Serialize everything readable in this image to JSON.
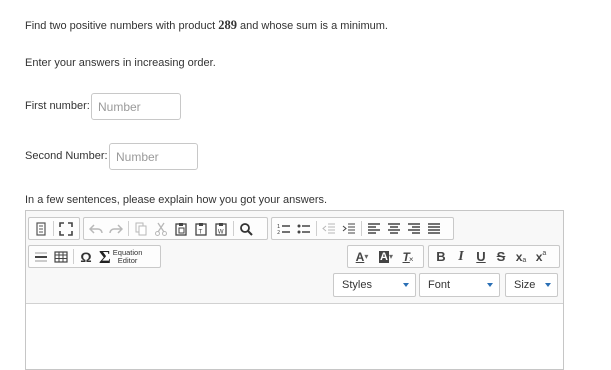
{
  "question": {
    "prefix": "Find two positive numbers with product ",
    "product": "289",
    "suffix": " and whose sum is a minimum."
  },
  "instruction": "Enter your answers in increasing order.",
  "first": {
    "label": "First number:",
    "placeholder": "Number",
    "value": ""
  },
  "second": {
    "label": "Second Number:",
    "placeholder": "Number",
    "value": ""
  },
  "explain_prompt": "In a few sentences, please explain how you got your answers.",
  "editor": {
    "toolbar_row1": [
      "source-icon",
      "maximize-icon",
      "undo-icon",
      "redo-icon",
      "copy-icon",
      "cut-icon",
      "paste-icon",
      "paste-text-icon",
      "paste-word-icon",
      "find-icon",
      "numbered-list-icon",
      "bulleted-list-icon",
      "outdent-icon",
      "indent-icon",
      "align-left-icon",
      "align-center-icon",
      "align-right-icon",
      "justify-icon"
    ],
    "toolbar_row2": [
      "horizontal-rule-icon",
      "table-icon",
      "special-char-icon",
      "equation-editor-icon"
    ],
    "special_char_glyph": "Ω",
    "equation_glyph": "Σ",
    "equation_label_1": "Equation",
    "equation_label_2": "Editor",
    "format_buttons": {
      "text_color": "A",
      "bg_color": "A",
      "remove_format": "T",
      "bold": "B",
      "italic": "I",
      "underline": "U",
      "strike": "S",
      "subscript": "x",
      "superscript": "x"
    },
    "styles_label": "Styles",
    "font_label": "Font",
    "size_label": "Size",
    "content": ""
  },
  "colors": {
    "accent": "#2a6fb5",
    "border": "#c6c6c6",
    "toolbar_bg": "#f8f8f8"
  }
}
